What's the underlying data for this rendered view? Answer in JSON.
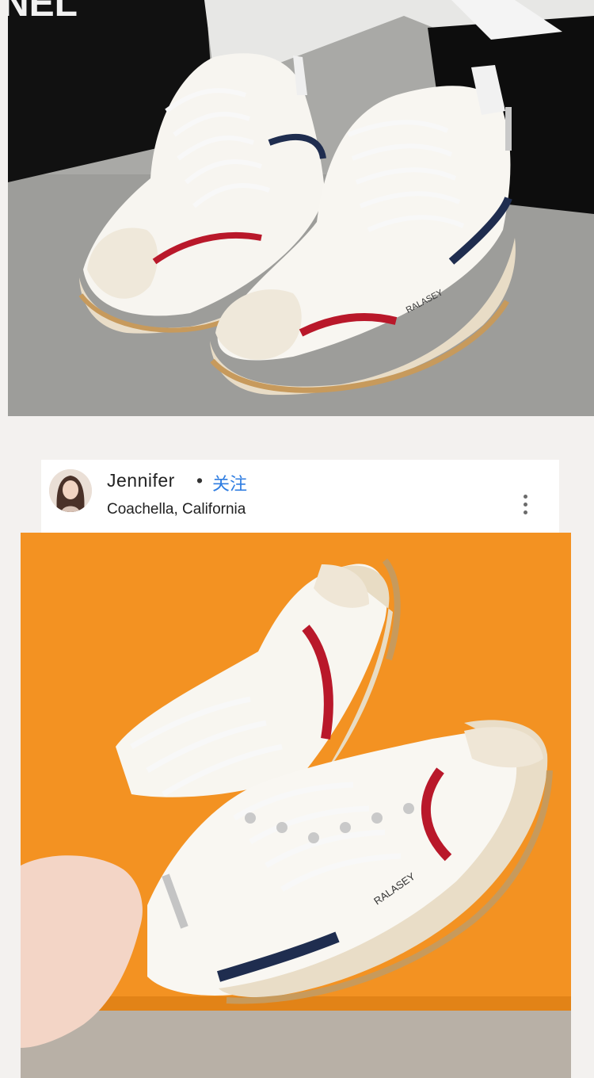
{
  "post": {
    "username": "Jennifer",
    "separator": "•",
    "follow_label": "关注",
    "location": "Coachella, California"
  },
  "images": {
    "top_brand_text": "NEL",
    "shoe_brand": "RALASEY"
  },
  "colors": {
    "accent_blue": "#2f7de1",
    "orange_background": "#f39222",
    "stripe_red": "#b9182a",
    "stripe_navy": "#1f2d4f"
  }
}
